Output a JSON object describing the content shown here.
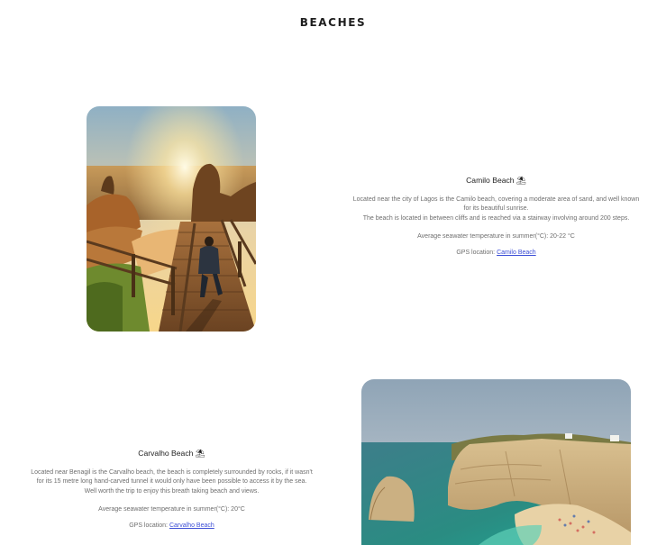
{
  "page": {
    "title": "BEACHES"
  },
  "beaches": [
    {
      "name": "Camilo Beach ⛱",
      "description_lines": [
        "Located near the city of Lagos is the Camilo beach, covering a moderate area of sand, and well known",
        "for its beautiful sunrise.",
        "The beach is located in between cliffs and is reached via a stairway involving around 200 steps."
      ],
      "temperature": "Average seawater temperature in summer(°C): 20-22 °C",
      "gps_label": "GPS location:",
      "gps_link": "Camilo Beach"
    },
    {
      "name": "Carvalho Beach ⛱",
      "description_lines": [
        "Located near Benagil is the Carvalho beach, the beach is completely surrounded by rocks, if it wasn't",
        "for its 15 metre long hand-carved tunnel it would only have been possible to access it by the sea.",
        "Well worth the trip to enjoy this breath taking beach and views."
      ],
      "temperature": "Average seawater temperature in summer(°C): 20°C",
      "gps_label": "GPS location:",
      "gps_link": "Carvalho Beach"
    }
  ]
}
